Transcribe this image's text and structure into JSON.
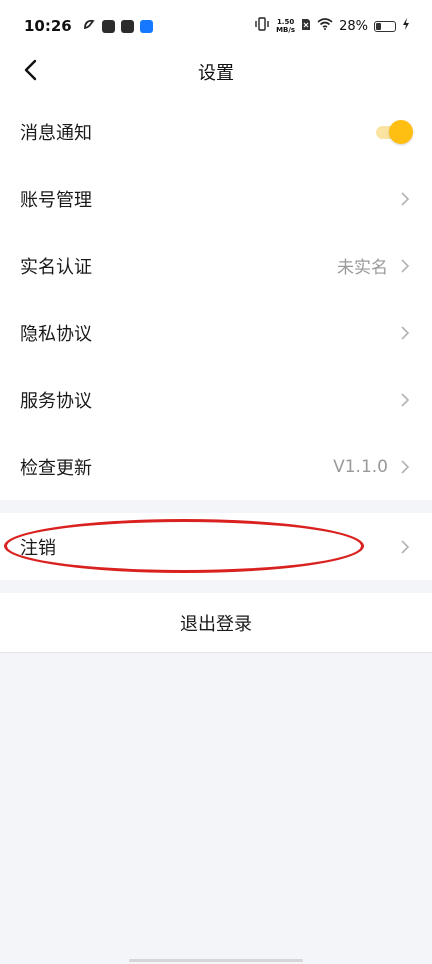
{
  "status_bar": {
    "time": "10:26",
    "net_speed_value": "1.50",
    "net_speed_unit": "MB/s",
    "battery_percent": "28%",
    "battery_level": 0.28,
    "icons": [
      "notification-app-icon",
      "mail-app-icon",
      "message-app-icon",
      "alipay-icon",
      "vibrate-icon",
      "sim-off-icon",
      "wifi-icon",
      "battery-icon",
      "charging-icon"
    ]
  },
  "header": {
    "title": "设置"
  },
  "settings": {
    "items": [
      {
        "label": "消息通知",
        "type": "toggle",
        "toggle_on": true
      },
      {
        "label": "账号管理",
        "type": "link"
      },
      {
        "label": "实名认证",
        "type": "link",
        "value": "未实名"
      },
      {
        "label": "隐私协议",
        "type": "link"
      },
      {
        "label": "服务协议",
        "type": "link"
      },
      {
        "label": "检查更新",
        "type": "link",
        "value": "V1.1.0"
      }
    ],
    "cancel": {
      "label": "注销"
    },
    "logout": {
      "label": "退出登录"
    }
  },
  "colors": {
    "toggle_active": "#ffbe12",
    "toggle_track": "#fbe4a2",
    "highlight_ring": "#d9221f",
    "page_background": "#f4f5f9"
  }
}
